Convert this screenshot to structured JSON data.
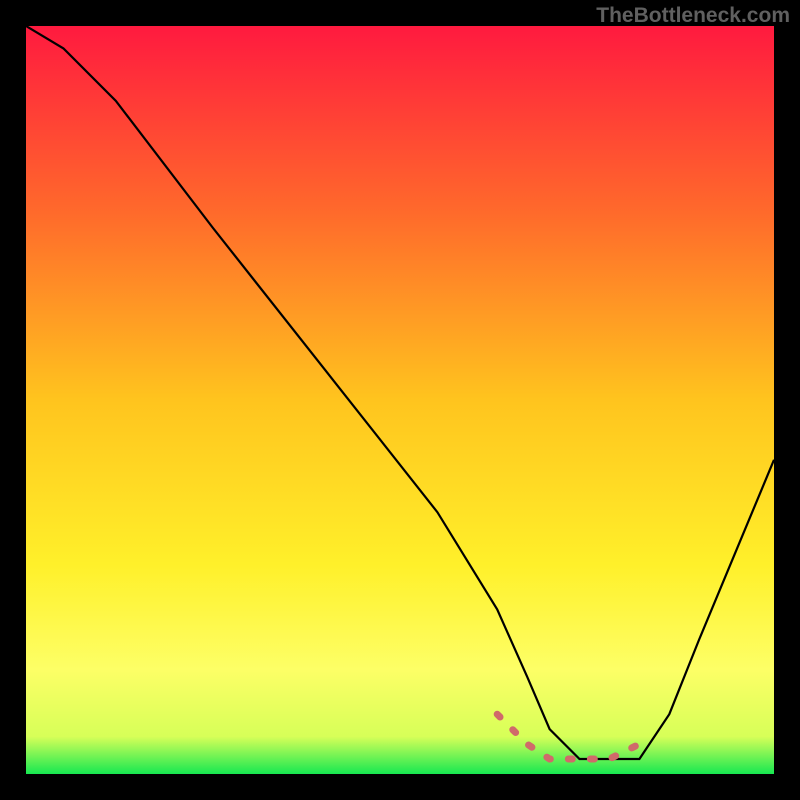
{
  "watermark": "TheBottleneck.com",
  "chart_data": {
    "type": "line",
    "title": "",
    "xlabel": "",
    "ylabel": "",
    "xlim": [
      0,
      100
    ],
    "ylim": [
      0,
      100
    ],
    "grid": false,
    "legend": false,
    "gradient": {
      "stops": [
        {
          "offset": 0,
          "color": "#ff1a3f"
        },
        {
          "offset": 25,
          "color": "#ff6a2b"
        },
        {
          "offset": 50,
          "color": "#ffc41e"
        },
        {
          "offset": 72,
          "color": "#fff02a"
        },
        {
          "offset": 86,
          "color": "#fdff66"
        },
        {
          "offset": 95,
          "color": "#d7ff58"
        },
        {
          "offset": 100,
          "color": "#17e851"
        }
      ]
    },
    "series": [
      {
        "name": "bottleneck-curve",
        "color": "#000000",
        "x": [
          0,
          5,
          12,
          25,
          40,
          55,
          63,
          67,
          70,
          74,
          78,
          82,
          86,
          90,
          95,
          100
        ],
        "y": [
          100,
          97,
          90,
          73,
          54,
          35,
          22,
          13,
          6,
          2,
          2,
          2,
          8,
          18,
          30,
          42
        ]
      },
      {
        "name": "highlight-band",
        "color": "#d06a6a",
        "x": [
          63,
          67,
          70,
          74,
          78,
          82
        ],
        "y": [
          8,
          4,
          2,
          2,
          2,
          4
        ]
      }
    ]
  }
}
